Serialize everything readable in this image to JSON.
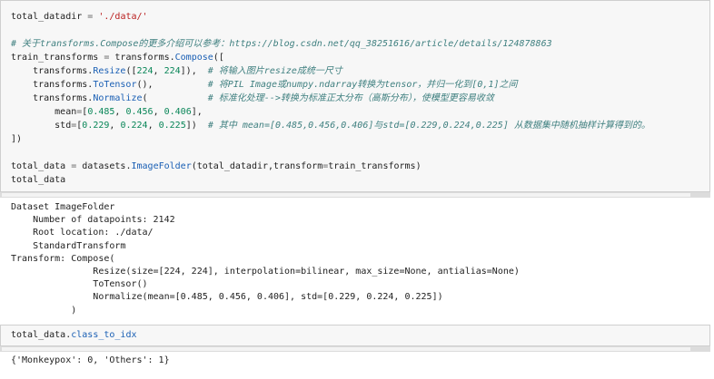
{
  "cell1": {
    "lines": [
      [
        {
          "t": "total_datadir ",
          "c": "pl"
        },
        {
          "t": "=",
          "c": "op"
        },
        {
          "t": " ",
          "c": "pl"
        },
        {
          "t": "'./data/'",
          "c": "st"
        }
      ],
      [],
      [
        {
          "t": "# 关于transforms.Compose的更多介绍可以参考：https://blog.csdn.net/qq_38251616/article/details/124878863",
          "c": "cm"
        }
      ],
      [
        {
          "t": "train_transforms ",
          "c": "pl"
        },
        {
          "t": "=",
          "c": "op"
        },
        {
          "t": " transforms.",
          "c": "pl"
        },
        {
          "t": "Compose",
          "c": "fn"
        },
        {
          "t": "([",
          "c": "pl"
        }
      ],
      [
        {
          "t": "    transforms.",
          "c": "pl"
        },
        {
          "t": "Resize",
          "c": "fn"
        },
        {
          "t": "([",
          "c": "pl"
        },
        {
          "t": "224",
          "c": "nm"
        },
        {
          "t": ", ",
          "c": "pl"
        },
        {
          "t": "224",
          "c": "nm"
        },
        {
          "t": "]),  ",
          "c": "pl"
        },
        {
          "t": "# 将输入图片resize成统一尺寸",
          "c": "cm"
        }
      ],
      [
        {
          "t": "    transforms.",
          "c": "pl"
        },
        {
          "t": "ToTensor",
          "c": "fn"
        },
        {
          "t": "(),          ",
          "c": "pl"
        },
        {
          "t": "# 将PIL Image或numpy.ndarray转换为tensor，并归一化到[0,1]之间",
          "c": "cm"
        }
      ],
      [
        {
          "t": "    transforms.",
          "c": "pl"
        },
        {
          "t": "Normalize",
          "c": "fn"
        },
        {
          "t": "(           ",
          "c": "pl"
        },
        {
          "t": "# 标准化处理-->转换为标准正太分布（高斯分布），使模型更容易收敛",
          "c": "cm"
        }
      ],
      [
        {
          "t": "        mean",
          "c": "pl"
        },
        {
          "t": "=",
          "c": "op"
        },
        {
          "t": "[",
          "c": "pl"
        },
        {
          "t": "0.485",
          "c": "nm"
        },
        {
          "t": ", ",
          "c": "pl"
        },
        {
          "t": "0.456",
          "c": "nm"
        },
        {
          "t": ", ",
          "c": "pl"
        },
        {
          "t": "0.406",
          "c": "nm"
        },
        {
          "t": "],",
          "c": "pl"
        }
      ],
      [
        {
          "t": "        std",
          "c": "pl"
        },
        {
          "t": "=",
          "c": "op"
        },
        {
          "t": "[",
          "c": "pl"
        },
        {
          "t": "0.229",
          "c": "nm"
        },
        {
          "t": ", ",
          "c": "pl"
        },
        {
          "t": "0.224",
          "c": "nm"
        },
        {
          "t": ", ",
          "c": "pl"
        },
        {
          "t": "0.225",
          "c": "nm"
        },
        {
          "t": "])  ",
          "c": "pl"
        },
        {
          "t": "# 其中 mean=[0.485,0.456,0.406]与std=[0.229,0.224,0.225] 从数据集中随机抽样计算得到的。",
          "c": "cm"
        }
      ],
      [
        {
          "t": "])",
          "c": "pl"
        }
      ],
      [],
      [
        {
          "t": "total_data ",
          "c": "pl"
        },
        {
          "t": "=",
          "c": "op"
        },
        {
          "t": " datasets.",
          "c": "pl"
        },
        {
          "t": "ImageFolder",
          "c": "fn"
        },
        {
          "t": "(total_datadir,transform",
          "c": "pl"
        },
        {
          "t": "=",
          "c": "op"
        },
        {
          "t": "train_transforms)",
          "c": "pl"
        }
      ],
      [
        {
          "t": "total_data",
          "c": "pl"
        }
      ]
    ]
  },
  "output1": {
    "lines": [
      "Dataset ImageFolder",
      "    Number of datapoints: 2142",
      "    Root location: ./data/",
      "    StandardTransform",
      "Transform: Compose(",
      "               Resize(size=[224, 224], interpolation=bilinear, max_size=None, antialias=None)",
      "               ToTensor()",
      "               Normalize(mean=[0.485, 0.456, 0.406], std=[0.229, 0.224, 0.225])",
      "           )"
    ]
  },
  "cell2": {
    "lines": [
      [
        {
          "t": "total_data.",
          "c": "pl"
        },
        {
          "t": "class_to_idx",
          "c": "fn"
        }
      ]
    ]
  },
  "output2": {
    "lines": [
      "{'Monkeypox': 0, 'Others': 1}"
    ]
  },
  "colors": {
    "comment": "#408080",
    "function": "#1a5fb4",
    "number": "#098658",
    "string": "#ba2121"
  }
}
